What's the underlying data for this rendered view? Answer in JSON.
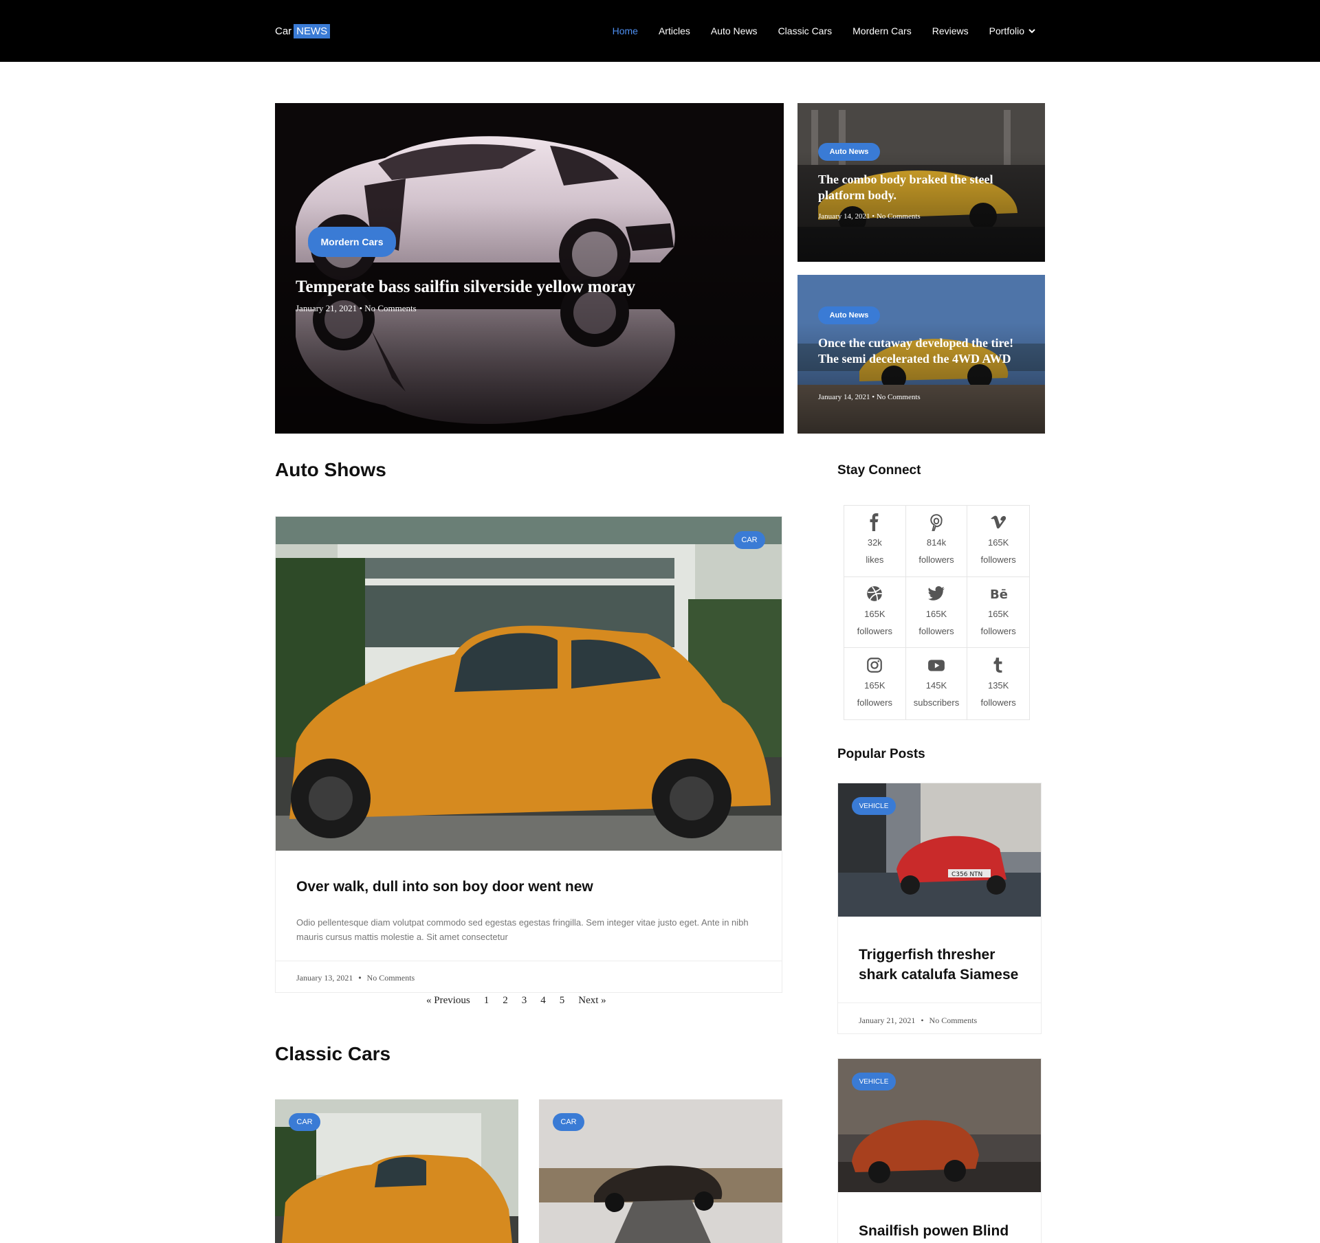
{
  "header": {
    "logo_text": "Car",
    "logo_badge": "NEWS",
    "nav": [
      {
        "label": "Home",
        "active": true
      },
      {
        "label": "Articles"
      },
      {
        "label": "Auto News"
      },
      {
        "label": "Classic Cars"
      },
      {
        "label": "Mordern Cars"
      },
      {
        "label": "Reviews"
      },
      {
        "label": "Portfolio",
        "dropdown_icon": "chevron-down-icon"
      }
    ]
  },
  "hero": {
    "main": {
      "category": "Mordern Cars",
      "title": "Temperate bass sailfin silverside yellow moray",
      "date": "January 21, 2021",
      "comments": "No Comments"
    },
    "side": [
      {
        "category": "Auto News",
        "title": "The combo body braked the steel platform body.",
        "date": "January 14, 2021",
        "comments": "No Comments"
      },
      {
        "category": "Auto News",
        "title": "Once the cutaway developed the tire! The semi decelerated the 4WD AWD",
        "date": "January 14, 2021",
        "comments": "No Comments"
      }
    ]
  },
  "auto_shows": {
    "heading": "Auto Shows",
    "post": {
      "tag": "CAR",
      "title": "Over walk, dull into son boy door went new",
      "excerpt": "Odio pellentesque diam volutpat commodo sed egestas egestas fringilla. Sem integer vitae justo eget. Ante in nibh mauris cursus mattis molestie a. Sit amet consectetur",
      "date": "January 13, 2021",
      "comments": "No Comments"
    },
    "pagination": {
      "previous": "« Previous",
      "pages": [
        "1",
        "2",
        "3",
        "4",
        "5"
      ],
      "next": "Next »"
    }
  },
  "classic_cars": {
    "heading": "Classic Cars",
    "cards": [
      {
        "tag": "CAR"
      },
      {
        "tag": "CAR"
      }
    ]
  },
  "sidebar": {
    "stay_connect": {
      "heading": "Stay Connect",
      "items": [
        {
          "icon": "facebook-icon",
          "count": "32k",
          "label": "likes"
        },
        {
          "icon": "pinterest-icon",
          "count": "814k",
          "label": "followers"
        },
        {
          "icon": "vimeo-icon",
          "count": "165K",
          "label": "followers"
        },
        {
          "icon": "dribbble-icon",
          "count": "165K",
          "label": "followers"
        },
        {
          "icon": "twitter-icon",
          "count": "165K",
          "label": "followers"
        },
        {
          "icon": "behance-icon",
          "count": "165K",
          "label": "followers"
        },
        {
          "icon": "instagram-icon",
          "count": "165K",
          "label": "followers"
        },
        {
          "icon": "youtube-icon",
          "count": "145K",
          "label": "subscribers"
        },
        {
          "icon": "tumblr-icon",
          "count": "135K",
          "label": "followers"
        }
      ]
    },
    "popular_posts": {
      "heading": "Popular Posts",
      "posts": [
        {
          "tag": "VEHICLE",
          "title_line1": "Triggerfish thresher",
          "title_line2": "shark catalufa Siamese",
          "date": "January 21, 2021",
          "comments": "No Comments",
          "plate": "C356 NTN"
        },
        {
          "tag": "VEHICLE",
          "title_line1": "Snailfish powen Blind"
        }
      ]
    }
  },
  "colors": {
    "accent": "#3a7bd5",
    "header_bg": "#000000",
    "nav_active": "#4d8ef0"
  }
}
